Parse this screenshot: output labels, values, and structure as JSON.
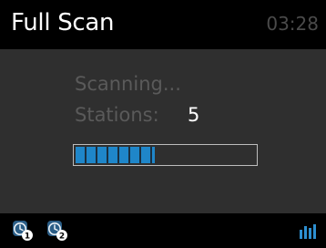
{
  "header": {
    "title": "Full Scan",
    "clock": "03:28"
  },
  "scan": {
    "status": "Scanning...",
    "stations_label": "Stations:",
    "stations_count": "5",
    "progress_fraction": 0.44
  },
  "footer": {
    "preset_icons": [
      {
        "icon": "alarm-clock-icon",
        "number": "1"
      },
      {
        "icon": "alarm-clock-icon",
        "number": "2"
      }
    ],
    "signal_icon": "signal-strength-icon"
  },
  "colors": {
    "accent": "#1f86c9",
    "background": "#2f2f2f",
    "header_background": "#000000",
    "dim_text": "#5a5a5a"
  }
}
